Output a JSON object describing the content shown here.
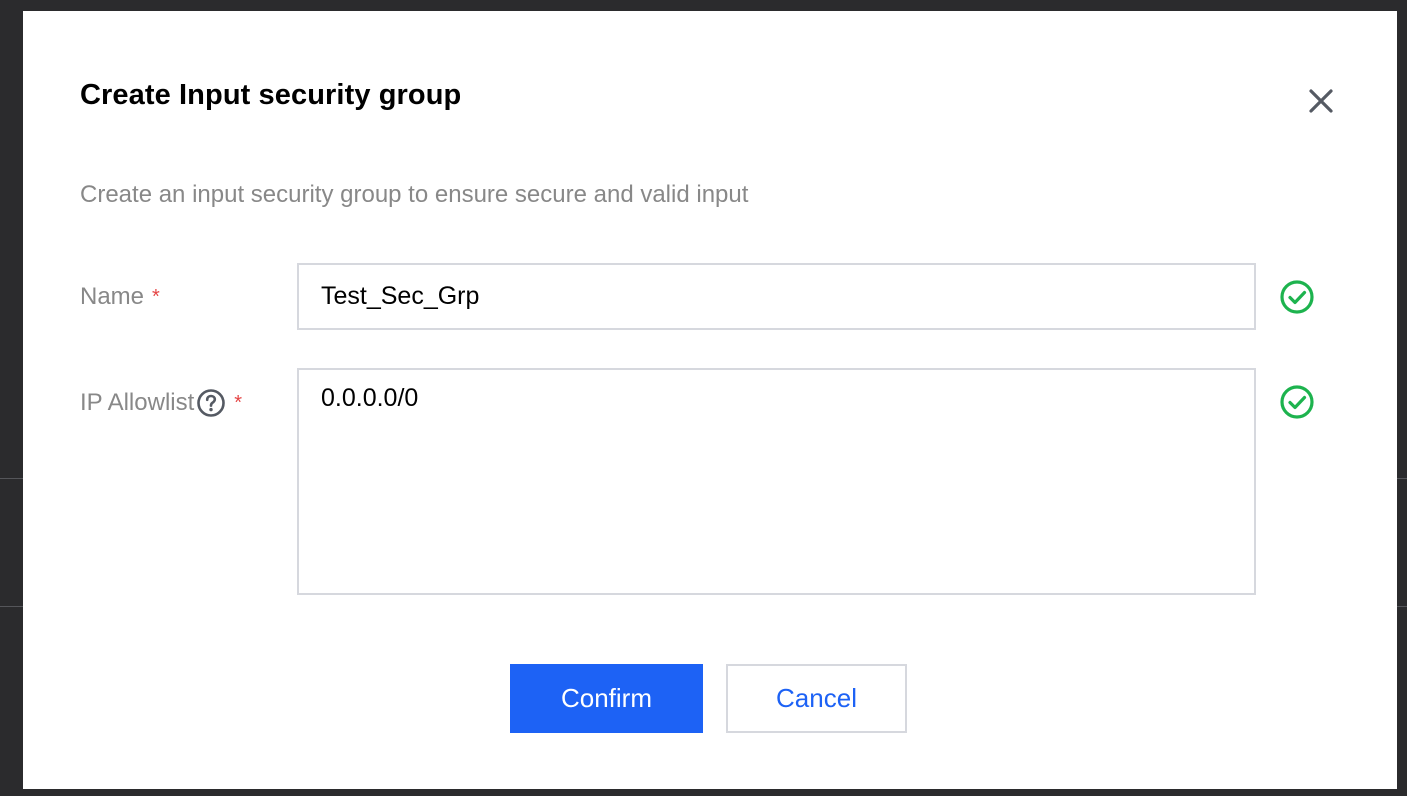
{
  "dialog": {
    "title": "Create Input security group",
    "description": "Create an input security group to ensure secure and valid input",
    "close_icon": "close-icon"
  },
  "form": {
    "name": {
      "label": "Name",
      "required_mark": "*",
      "value": "Test_Sec_Grp",
      "status_icon": "check-circle-icon",
      "status": "valid"
    },
    "ip_allowlist": {
      "label": "IP Allowlist",
      "required_mark": "*",
      "help_icon": "question-circle-icon",
      "value": "0.0.0.0/0",
      "status_icon": "check-circle-icon",
      "status": "valid"
    }
  },
  "buttons": {
    "confirm_label": "Confirm",
    "cancel_label": "Cancel"
  },
  "colors": {
    "primary": "#1d62f5",
    "success": "#1db34e",
    "required": "#e54545",
    "muted_text": "#888888"
  }
}
